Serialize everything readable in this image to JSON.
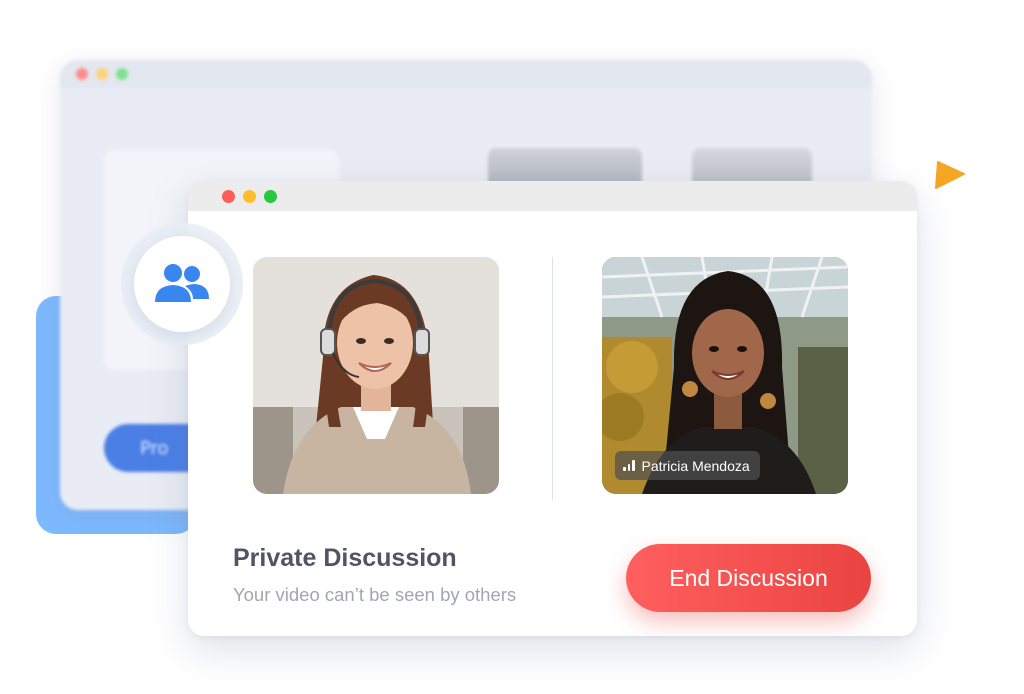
{
  "back_window": {
    "button_label": "Pro"
  },
  "call": {
    "participant_right": {
      "name": "Patricia Mendoza"
    },
    "info": {
      "title": "Private Discussion",
      "subtitle": "Your video can’t be seen by others"
    },
    "end_button_label": "End Discussion"
  },
  "icons": {
    "group": "users-group-icon",
    "play": "play-triangle-icon",
    "signal": "signal-bars-icon"
  },
  "colors": {
    "accent_blue": "#3a86f0",
    "end_button": "#ef4b4b",
    "play_orange": "#f5a623",
    "title_text": "#505467",
    "subtitle_text": "#a2a6b1"
  }
}
